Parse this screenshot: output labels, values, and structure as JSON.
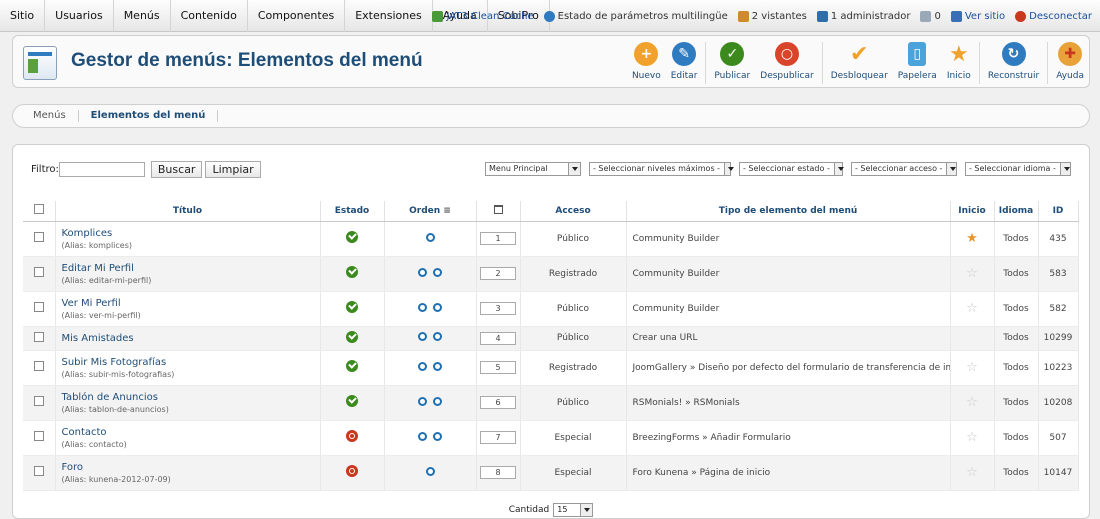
{
  "topmenu": [
    "Sitio",
    "Usuarios",
    "Menús",
    "Contenido",
    "Componentes",
    "Extensiones",
    "Ayuda",
    "SobiPro"
  ],
  "status": {
    "cache": "JAT3 Clean Cache",
    "multilang": "Estado de parámetros multilingüe",
    "visitors": "2 vistantes",
    "admins": "1 administrador",
    "messages": "0",
    "view_site": "Ver sitio",
    "logout": "Desconectar"
  },
  "page": {
    "title": "Gestor de menús: Elementos del menú"
  },
  "toolbar": {
    "nuevo": "Nuevo",
    "editar": "Editar",
    "publicar": "Publicar",
    "despublicar": "Despublicar",
    "desbloquear": "Desbloquear",
    "papelera": "Papelera",
    "inicio": "Inicio",
    "reconstruir": "Reconstruir",
    "ayuda": "Ayuda"
  },
  "submenu": [
    "Menús",
    "Elementos del menú"
  ],
  "filter": {
    "label": "Filtro:",
    "value": "",
    "search_btn": "Buscar",
    "clear_btn": "Limpiar",
    "menu_select": "Menu Principal",
    "levels_select": "- Seleccionar niveles máximos -",
    "state_select": "- Seleccionar estado -",
    "access_select": "- Seleccionar acceso -",
    "language_select": "- Seleccionar idioma -"
  },
  "columns": {
    "titulo": "Título",
    "estado": "Estado",
    "orden": "Orden",
    "acceso": "Acceso",
    "tipo": "Tipo de elemento del menú",
    "inicio": "Inicio",
    "idioma": "Idioma",
    "id": "ID"
  },
  "rows": [
    {
      "title": "Komplices",
      "alias": "(Alias: komplices)",
      "state": "published",
      "up": false,
      "down": true,
      "order": "1",
      "access": "Público",
      "type": "Community Builder",
      "home": true,
      "lang": "Todos",
      "id": "435"
    },
    {
      "title": "Editar Mi Perfil",
      "alias": "(Alias: editar-mi-perfil)",
      "state": "published",
      "up": true,
      "down": true,
      "order": "2",
      "access": "Registrado",
      "type": "Community Builder",
      "home": false,
      "lang": "Todos",
      "id": "583"
    },
    {
      "title": "Ver Mi Perfil",
      "alias": "(Alias: ver-mi-perfil)",
      "state": "published",
      "up": true,
      "down": true,
      "order": "3",
      "access": "Público",
      "type": "Community Builder",
      "home": false,
      "lang": "Todos",
      "id": "582"
    },
    {
      "title": "Mis Amistades",
      "alias": "",
      "state": "published",
      "up": true,
      "down": true,
      "order": "4",
      "access": "Público",
      "type": "Crear una URL",
      "home": null,
      "lang": "Todos",
      "id": "10299"
    },
    {
      "title": "Subir Mis Fotografías",
      "alias": "(Alias: subir-mis-fotografias)",
      "state": "published",
      "up": true,
      "down": true,
      "order": "5",
      "access": "Registrado",
      "type": "JoomGallery » Diseño por defecto del formulario de transferencia de imágenes.",
      "home": false,
      "lang": "Todos",
      "id": "10223"
    },
    {
      "title": "Tablón de Anuncios",
      "alias": "(Alias: tablon-de-anuncios)",
      "state": "published",
      "up": true,
      "down": true,
      "order": "6",
      "access": "Público",
      "type": "RSMonials! » RSMonials",
      "home": false,
      "lang": "Todos",
      "id": "10208"
    },
    {
      "title": "Contacto",
      "alias": "(Alias: contacto)",
      "state": "unpublished",
      "up": true,
      "down": true,
      "order": "7",
      "access": "Especial",
      "type": "BreezingForms » Añadir Formulario",
      "home": false,
      "lang": "Todos",
      "id": "507"
    },
    {
      "title": "Foro",
      "alias": "(Alias: kunena-2012-07-09)",
      "state": "unpublished",
      "up": true,
      "down": false,
      "order": "8",
      "access": "Especial",
      "type": "Foro Kunena » Página de inicio",
      "home": false,
      "lang": "Todos",
      "id": "10147"
    }
  ],
  "footer": {
    "label": "Cantidad",
    "value": "15"
  },
  "colors": {
    "title": "#1e4d78",
    "published": "#3c8a1e",
    "unpublished": "#c7381d",
    "home_star": "#e8962c"
  },
  "icons": {
    "nuevo": "plus-circle-icon",
    "editar": "pencil-icon",
    "publicar": "check-icon",
    "despublicar": "circle-x-icon",
    "desbloquear": "check-mark-icon",
    "papelera": "trash-icon",
    "inicio": "star-icon",
    "reconstruir": "refresh-icon",
    "ayuda": "help-icon"
  }
}
